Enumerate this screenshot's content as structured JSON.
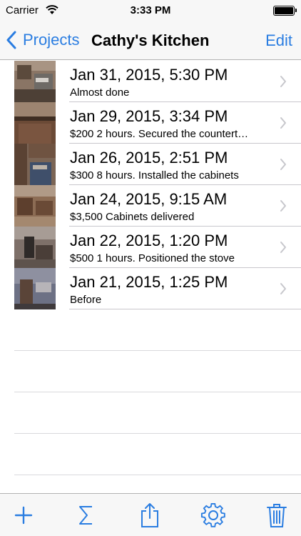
{
  "status_bar": {
    "carrier": "Carrier",
    "time": "3:33 PM"
  },
  "nav": {
    "back_label": "Projects",
    "title": "Cathy's Kitchen",
    "edit_label": "Edit"
  },
  "entries": [
    {
      "title": "Jan 31, 2015, 5:30 PM",
      "subtitle": "Almost done"
    },
    {
      "title": "Jan 29, 2015, 3:34 PM",
      "subtitle": "$200 2 hours. Secured the countert…"
    },
    {
      "title": "Jan 26, 2015, 2:51 PM",
      "subtitle": "$300 8 hours. Installed the cabinets"
    },
    {
      "title": "Jan 24, 2015, 9:15 AM",
      "subtitle": "$3,500 Cabinets delivered"
    },
    {
      "title": "Jan 22, 2015, 1:20 PM",
      "subtitle": "$500 1 hours. Positioned the stove"
    },
    {
      "title": "Jan 21, 2015, 1:25 PM",
      "subtitle": "Before"
    }
  ],
  "toolbar": {
    "items": [
      "add-icon",
      "sum-icon",
      "share-icon",
      "settings-icon",
      "trash-icon"
    ]
  },
  "colors": {
    "accent": "#2a7de1",
    "bar_background": "#f7f7f7"
  }
}
